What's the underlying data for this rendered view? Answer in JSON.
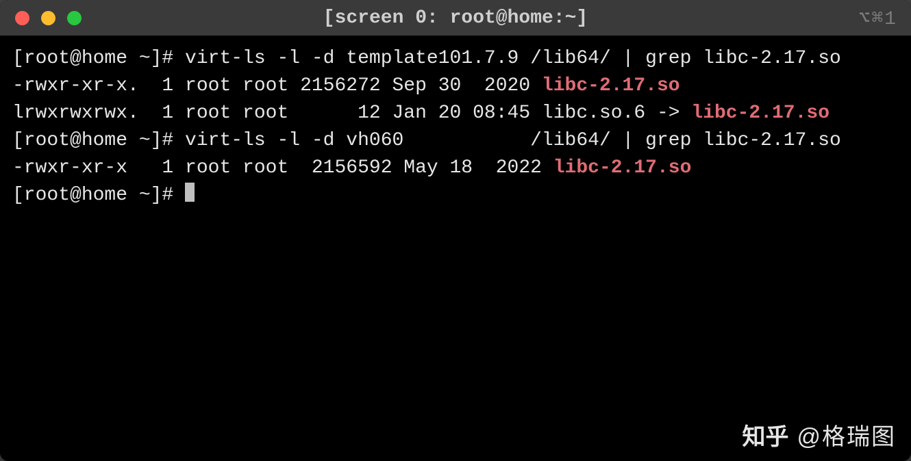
{
  "window": {
    "title": "[screen 0: root@home:~]",
    "right_indicator": "⌥⌘1"
  },
  "terminal": {
    "prompt": "[root@home ~]# ",
    "lines": [
      {
        "kind": "cmd",
        "text": "virt-ls -l -d template101.7.9 /lib64/ | grep libc-2.17.so"
      },
      {
        "kind": "out",
        "prefix": "-rwxr-xr-x.  1 root root 2156272 Sep 30  2020 ",
        "hl": "libc-2.17.so",
        "suffix": ""
      },
      {
        "kind": "out",
        "prefix": "lrwxrwxrwx.  1 root root      12 Jan 20 08:45 libc.so.6 -> ",
        "hl": "libc-2.17.so",
        "suffix": ""
      },
      {
        "kind": "cmd",
        "text": "virt-ls -l -d vh060           /lib64/ | grep libc-2.17.so"
      },
      {
        "kind": "out",
        "prefix": "-rwxr-xr-x   1 root root  2156592 May 18  2022 ",
        "hl": "libc-2.17.so",
        "suffix": ""
      },
      {
        "kind": "prompt",
        "text": ""
      }
    ]
  },
  "watermark": {
    "logo": "知乎",
    "author": "@格瑞图"
  }
}
